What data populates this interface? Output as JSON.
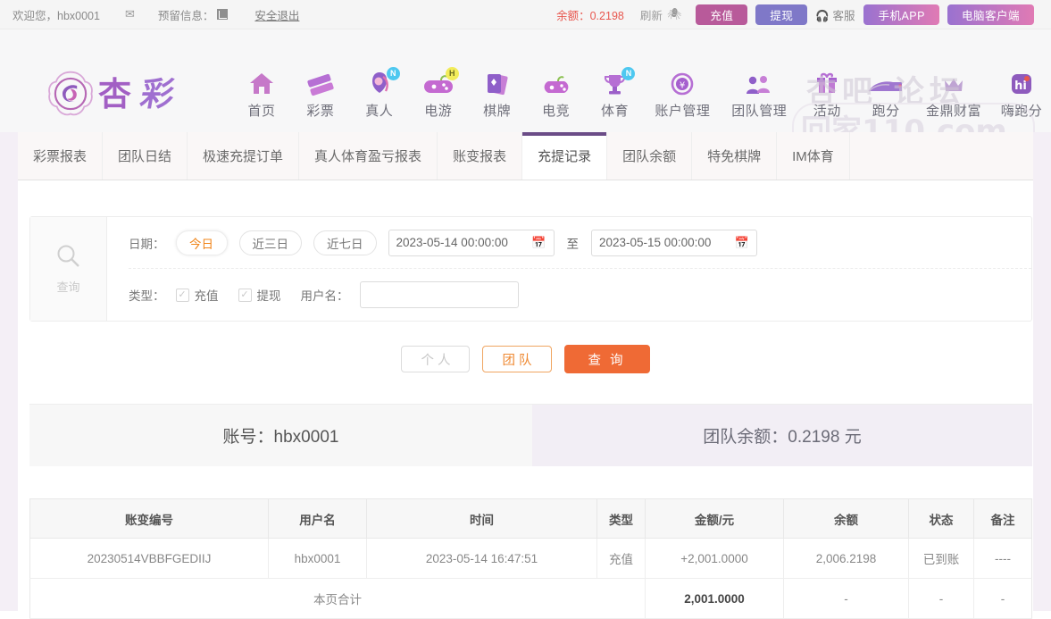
{
  "topbar": {
    "welcome": "欢迎您，hbx0001",
    "mail_icon": "envelope-icon",
    "reserve_label": "预留信息：",
    "logout": "安全退出",
    "balance": "余额：0.2198",
    "refresh": "刷新",
    "eye_icon": "eye-off-icon",
    "recharge": "充值",
    "withdraw": "提现",
    "service": "客服",
    "app": "手机APP",
    "pc_client": "电脑客户端",
    "colors": {
      "balance": "#e8574f",
      "recharge_bg": "#b85a9a",
      "withdraw_bg": "#7f78c8",
      "app_bg": "#c177c6"
    }
  },
  "nav": {
    "brand": "杏彩",
    "items": [
      {
        "label": "首页",
        "icon": "home-icon",
        "badge": ""
      },
      {
        "label": "彩票",
        "icon": "ticket-icon",
        "badge": ""
      },
      {
        "label": "真人",
        "icon": "dealer-icon",
        "badge": "N"
      },
      {
        "label": "电游",
        "icon": "gamepad-icon",
        "badge": "H"
      },
      {
        "label": "棋牌",
        "icon": "cards-icon",
        "badge": ""
      },
      {
        "label": "电竞",
        "icon": "esports-icon",
        "badge": ""
      },
      {
        "label": "体育",
        "icon": "trophy-icon",
        "badge": "N"
      },
      {
        "label": "账户管理",
        "icon": "coin-icon",
        "badge": ""
      },
      {
        "label": "团队管理",
        "icon": "team-icon",
        "badge": ""
      },
      {
        "label": "活动",
        "icon": "gift-icon",
        "badge": ""
      },
      {
        "label": "跑分",
        "icon": "run-icon",
        "badge": ""
      },
      {
        "label": "金鼎财富",
        "icon": "crown-icon",
        "badge": ""
      },
      {
        "label": "嗨跑分",
        "icon": "hi-icon",
        "badge": ""
      }
    ],
    "watermark_top": "杏吧 论坛",
    "watermark_main": "回家110.com"
  },
  "tabs": {
    "items": [
      {
        "label": "彩票报表",
        "active": false
      },
      {
        "label": "团队日结",
        "active": false
      },
      {
        "label": "极速充提订单",
        "active": false
      },
      {
        "label": "真人体育盈亏报表",
        "active": false
      },
      {
        "label": "账变报表",
        "active": false
      },
      {
        "label": "充提记录",
        "active": true
      },
      {
        "label": "团队余额",
        "active": false
      },
      {
        "label": "特免棋牌",
        "active": false
      },
      {
        "label": "IM体育",
        "active": false
      }
    ],
    "active_color": "#6b4c87"
  },
  "search": {
    "icon": "magnifier-icon",
    "icon_label": "查询",
    "date_label": "日期：",
    "quick_ranges": [
      {
        "label": "今日",
        "selected": true
      },
      {
        "label": "近三日",
        "selected": false
      },
      {
        "label": "近七日",
        "selected": false
      }
    ],
    "date_from": "2023-05-14 00:00:00",
    "date_to": "2023-05-15 00:00:00",
    "between": "至",
    "calendar_icon": "calendar-icon",
    "type_label": "类型：",
    "type_options": [
      {
        "label": "充值",
        "checked": true
      },
      {
        "label": "提现",
        "checked": true
      }
    ],
    "username_label": "用户名：",
    "username_value": "",
    "username_placeholder": ""
  },
  "actions": {
    "personal": "个 人",
    "team": "团 队",
    "query": "查 询",
    "query_bg": "#ef6a35"
  },
  "summary": {
    "account_label": "账号：hbx0001",
    "team_balance_label": "团队余额：0.2198 元"
  },
  "table": {
    "columns": [
      "账变编号",
      "用户名",
      "时间",
      "类型",
      "金额/元",
      "余额",
      "状态",
      "备注"
    ],
    "rows": [
      {
        "id": "20230514VBBFGEDIIJ",
        "username": "hbx0001",
        "time": "2023-05-14 16:47:51",
        "type": "充值",
        "amount": "+2,001.0000",
        "balance": "2,006.2198",
        "status": "已到账",
        "remark": "----"
      }
    ],
    "total_row": {
      "label": "本页合计",
      "amount": "2,001.0000",
      "balance": "-",
      "status": "-",
      "remark": "-"
    },
    "amount_color": "#8cc152"
  }
}
